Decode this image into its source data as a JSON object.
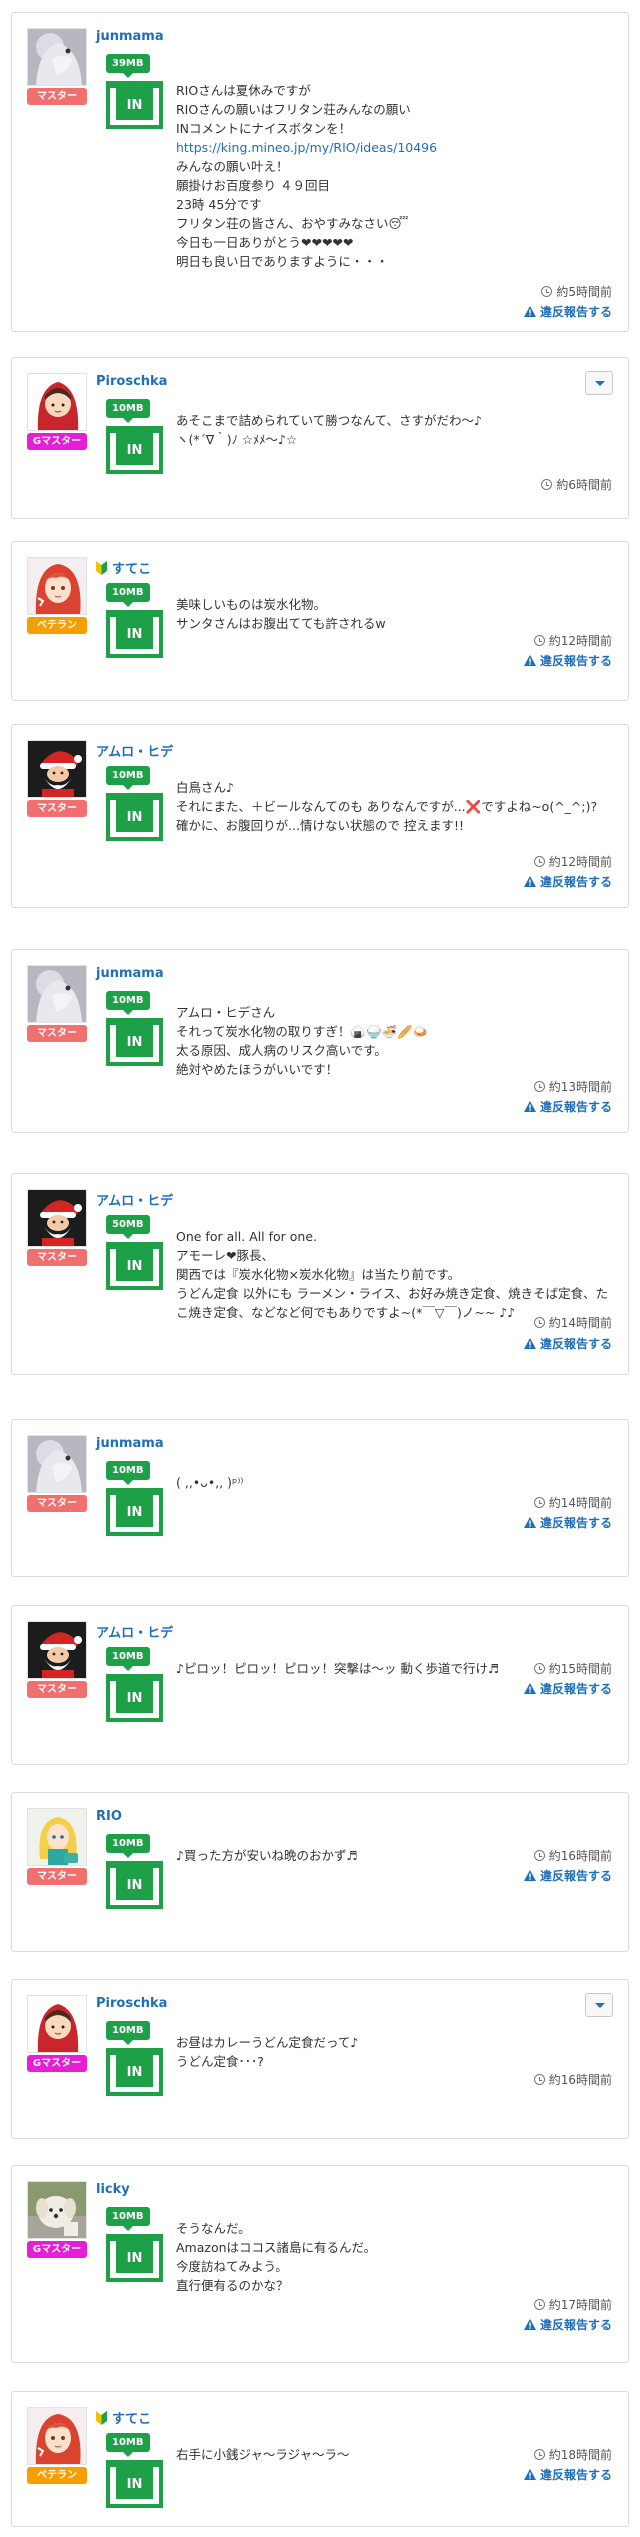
{
  "comments": [
    {
      "user": "junmama",
      "rank": "マスター",
      "mb": "39MB",
      "in_label": "IN",
      "text_lines": [
        "RIOさんは夏休みですが",
        "RIOさんの願いはフリタン荘みんなの願い",
        "INコメントにナイスボタンを！"
      ],
      "link": "https://king.mineo.jp/my/RIO/ideas/10496",
      "text_lines_after": [
        "みんなの願い叶え！",
        "願掛けお百度参り ４９回目",
        "23時 45分です",
        "フリタン荘の皆さん、おやすみなさい😴",
        "今日も一日ありがとう❤❤❤❤❤",
        "明日も良い日でありますように・・・"
      ],
      "time": "約5時間前",
      "report": "違反報告する"
    },
    {
      "user": "Piroschka",
      "rank": "Gマスター",
      "mb": "10MB",
      "in_label": "IN",
      "text_lines": [
        "あそこまで詰められていて勝つなんて、さすがだわ〜♪",
        "ヽ(*´∇｀)ﾉ ☆ﾒﾒ〜♪☆"
      ],
      "time": "約6時間前"
    },
    {
      "user": "すてこ",
      "rank": "ベテラン",
      "mb": "10MB",
      "in_label": "IN",
      "text_lines": [
        "美味しいものは炭水化物。",
        "サンタさんはお腹出てても許されるw"
      ],
      "time": "約12時間前",
      "report": "違反報告する"
    },
    {
      "user": "アムロ・ヒデ",
      "rank": "マスター",
      "mb": "10MB",
      "in_label": "IN",
      "text_lines": [
        "白鳥さん♪",
        "それにまた、＋ビールなんてのも ありなんですが...❌ですよね~o(^_^;)?",
        "確かに、お腹回りが...情けない状態ので 控えます!!"
      ],
      "time": "約12時間前",
      "report": "違反報告する"
    },
    {
      "user": "junmama",
      "rank": "マスター",
      "mb": "10MB",
      "in_label": "IN",
      "text_lines": [
        "アムロ・ヒデさん",
        "それって炭水化物の取りすぎ！🍙🍚🍜🥖🍛",
        "太る原因、成人病のリスク高いです。",
        "絶対やめたほうがいいです！"
      ],
      "time": "約13時間前",
      "report": "違反報告する"
    },
    {
      "user": "アムロ・ヒデ",
      "rank": "マスター",
      "mb": "50MB",
      "in_label": "IN",
      "text_lines": [
        "One for all. All for one.",
        "アモーレ❤豚長、",
        "関西では『炭水化物×炭水化物』は当たり前です。",
        "うどん定食 以外にも ラーメン・ライス、お好み焼き定食、焼きそば定食、たこ焼き定食、などなど何でもありですよ~(*￣▽￣)ノ~~ ♪♪"
      ],
      "time": "約14時間前",
      "report": "違反報告する"
    },
    {
      "user": "junmama",
      "rank": "マスター",
      "mb": "10MB",
      "in_label": "IN",
      "text_lines": [
        "( ,,•ᴗ•,, )ᵖ⁾⁾"
      ],
      "time": "約14時間前",
      "report": "違反報告する"
    },
    {
      "user": "アムロ・ヒデ",
      "rank": "マスター",
      "mb": "10MB",
      "in_label": "IN",
      "text_lines": [
        "♪ピロッ！ピロッ！ピロッ！突撃は〜ッ 動く歩道で行け♬"
      ],
      "time": "約15時間前",
      "report": "違反報告する"
    },
    {
      "user": "RIO",
      "rank": "マスター",
      "mb": "10MB",
      "in_label": "IN",
      "text_lines": [
        "♪買った方が安いね晩のおかず♬"
      ],
      "time": "約16時間前",
      "report": "違反報告する"
    },
    {
      "user": "Piroschka",
      "rank": "Gマスター",
      "mb": "10MB",
      "in_label": "IN",
      "text_lines": [
        "お昼はカレーうどん定食だって♪",
        "うどん定食･･･?"
      ],
      "time": "約16時間前"
    },
    {
      "user": "licky",
      "rank": "Gマスター",
      "mb": "10MB",
      "in_label": "IN",
      "text_lines": [
        "そうなんだ。",
        "Amazonはココス諸島に有るんだ。",
        "今度訪ねてみよう。",
        "直行便有るのかな？"
      ],
      "time": "約17時間前",
      "report": "違反報告する"
    },
    {
      "user": "すてこ",
      "rank": "ベテラン",
      "mb": "10MB",
      "in_label": "IN",
      "text_lines": [
        "右手に小銭ジャ〜ラジャ〜ラ〜"
      ],
      "time": "約18時間前",
      "report": "違反報告する"
    }
  ],
  "icons": {
    "clock": "clock-icon",
    "warning": "warning-icon",
    "beginner": "beginner-icon",
    "dropdown": "chevron-down-icon"
  },
  "colors": {
    "link": "#1f6fb8",
    "mb_green": "#1ea048",
    "rank_master": "#f0706f",
    "rank_gmaster": "#e51fd6",
    "rank_veteran": "#f5a000"
  }
}
